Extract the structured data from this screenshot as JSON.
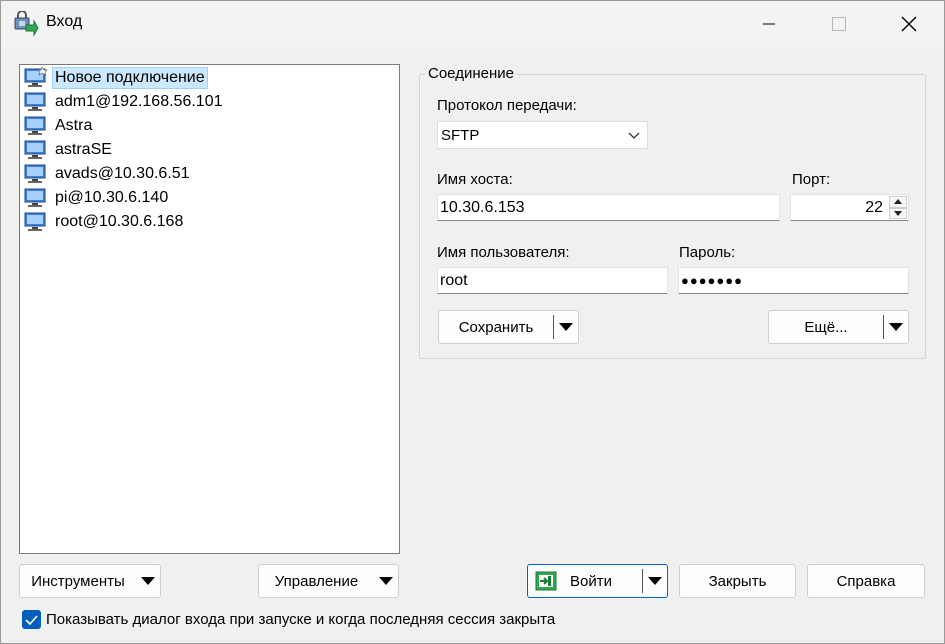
{
  "window": {
    "title": "Вход",
    "icon": "winscp-login-icon"
  },
  "sessions": [
    {
      "label": "Новое подключение",
      "icon": "new-site-icon",
      "selected": true
    },
    {
      "label": "adm1@192.168.56.101",
      "icon": "computer-icon"
    },
    {
      "label": "Astra",
      "icon": "computer-icon"
    },
    {
      "label": "astraSE",
      "icon": "computer-icon"
    },
    {
      "label": "avads@10.30.6.51",
      "icon": "computer-icon"
    },
    {
      "label": "pi@10.30.6.140",
      "icon": "computer-icon"
    },
    {
      "label": "root@10.30.6.168",
      "icon": "computer-icon"
    }
  ],
  "connection": {
    "group_title": "Соединение",
    "protocol_label": "Протокол передачи:",
    "protocol_value": "SFTP",
    "host_label": "Имя хоста:",
    "host_value": "10.30.6.153",
    "port_label": "Порт:",
    "port_value": "22",
    "user_label": "Имя пользователя:",
    "user_value": "root",
    "password_label": "Пароль:",
    "password_value": "●●●●●●●",
    "save_label": "Сохранить",
    "more_label": "Ещё..."
  },
  "bottom": {
    "tools_label": "Инструменты",
    "manage_label": "Управление",
    "login_label": "Войти",
    "close_label": "Закрыть",
    "help_label": "Справка",
    "show_dialog_label": "Показывать диалог входа при запуске и когда последняя сессия закрыта",
    "show_dialog_checked": true
  },
  "colors": {
    "accent": "#005fb8",
    "selection": "#cce8ff"
  }
}
